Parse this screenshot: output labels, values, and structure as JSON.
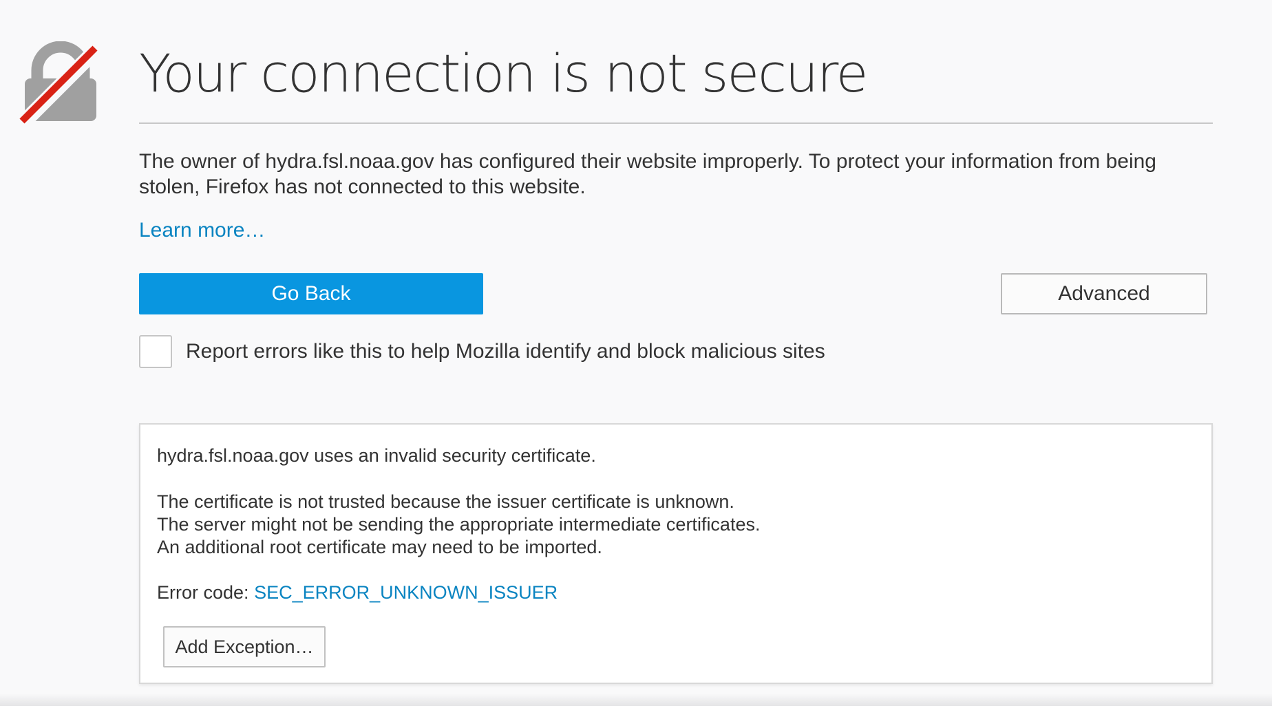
{
  "page": {
    "title": "Your connection is not secure",
    "description": "The owner of hydra.fsl.noaa.gov has configured their website improperly. To protect your information from being stolen, Firefox has not connected to this website.",
    "learn_more": "Learn more…",
    "icon": "broken-lock-icon"
  },
  "actions": {
    "go_back_label": "Go Back",
    "advanced_label": "Advanced"
  },
  "report": {
    "checked": false,
    "label": "Report errors like this to help Mozilla identify and block malicious sites"
  },
  "advanced_panel": {
    "line1": "hydra.fsl.noaa.gov uses an invalid security certificate.",
    "line2": "The certificate is not trusted because the issuer certificate is unknown.",
    "line3": "The server might not be sending the appropriate intermediate certificates.",
    "line4": "An additional root certificate may need to be imported.",
    "error_code_label": "Error code: ",
    "error_code": "SEC_ERROR_UNKNOWN_ISSUER",
    "add_exception_label": "Add Exception…"
  },
  "colors": {
    "primary_button": "#0996e0",
    "link": "#0a84c1",
    "warning_slash": "#d92215",
    "lock_gray": "#a0a0a0",
    "background": "#f9f9fa"
  }
}
